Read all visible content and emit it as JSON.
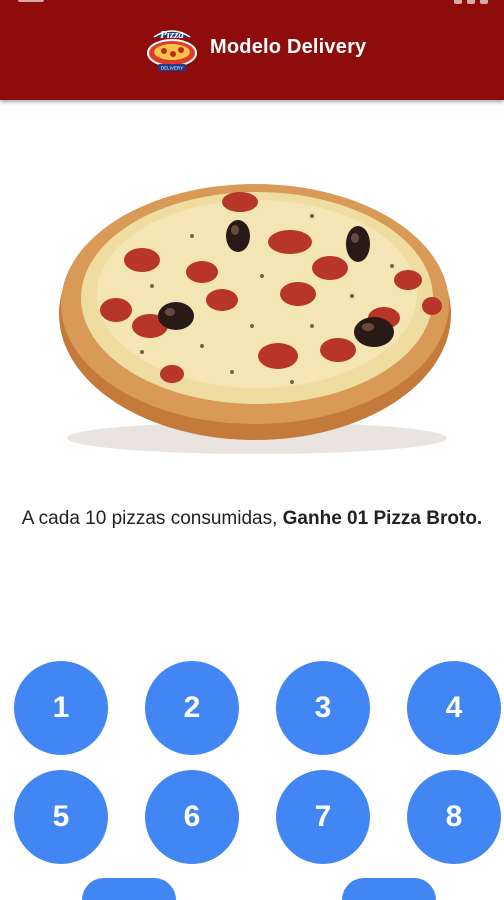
{
  "header": {
    "title": "Modelo Delivery",
    "logo_text": "Pizza",
    "logo_subtext": "DELIVERY",
    "background_color": "#8e0c0c"
  },
  "hero": {
    "image": "pizza-photo"
  },
  "promo": {
    "text_regular": "A cada 10 pizzas consumidas, ",
    "text_bold": "Ganhe 01 Pizza Broto."
  },
  "stamps": {
    "color": "#4286f4",
    "items": [
      {
        "label": "1"
      },
      {
        "label": "2"
      },
      {
        "label": "3"
      },
      {
        "label": "4"
      },
      {
        "label": "5"
      },
      {
        "label": "6"
      },
      {
        "label": "7"
      },
      {
        "label": "8"
      },
      {
        "label": ""
      },
      {
        "label": ""
      }
    ]
  }
}
